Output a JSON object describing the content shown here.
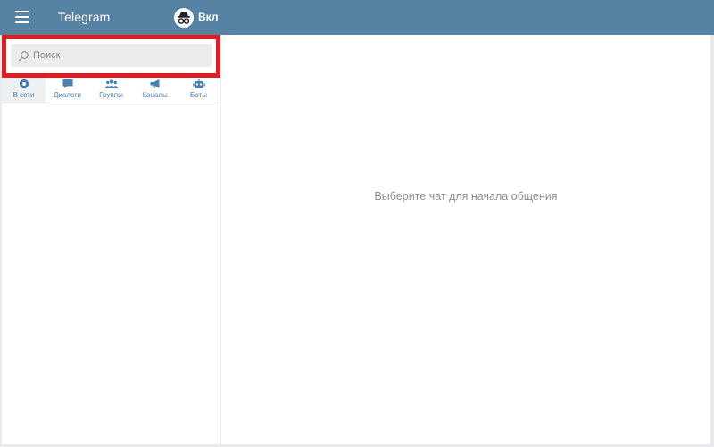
{
  "header": {
    "title": "Telegram",
    "incognito_label": "Вкл"
  },
  "search": {
    "placeholder": "Поиск"
  },
  "tabs": [
    {
      "label": "В сети",
      "icon": "online-dot-icon",
      "active": true
    },
    {
      "label": "Диалоги",
      "icon": "chat-bubble-icon",
      "active": false
    },
    {
      "label": "Группы",
      "icon": "group-icon",
      "active": false
    },
    {
      "label": "Каналы",
      "icon": "megaphone-icon",
      "active": false
    },
    {
      "label": "Боты",
      "icon": "robot-icon",
      "active": false
    }
  ],
  "main": {
    "empty_message": "Выберите чат для начала общения"
  },
  "colors": {
    "header": "#5682a3",
    "accent": "#4a7fb0",
    "highlight": "#e31b23"
  }
}
